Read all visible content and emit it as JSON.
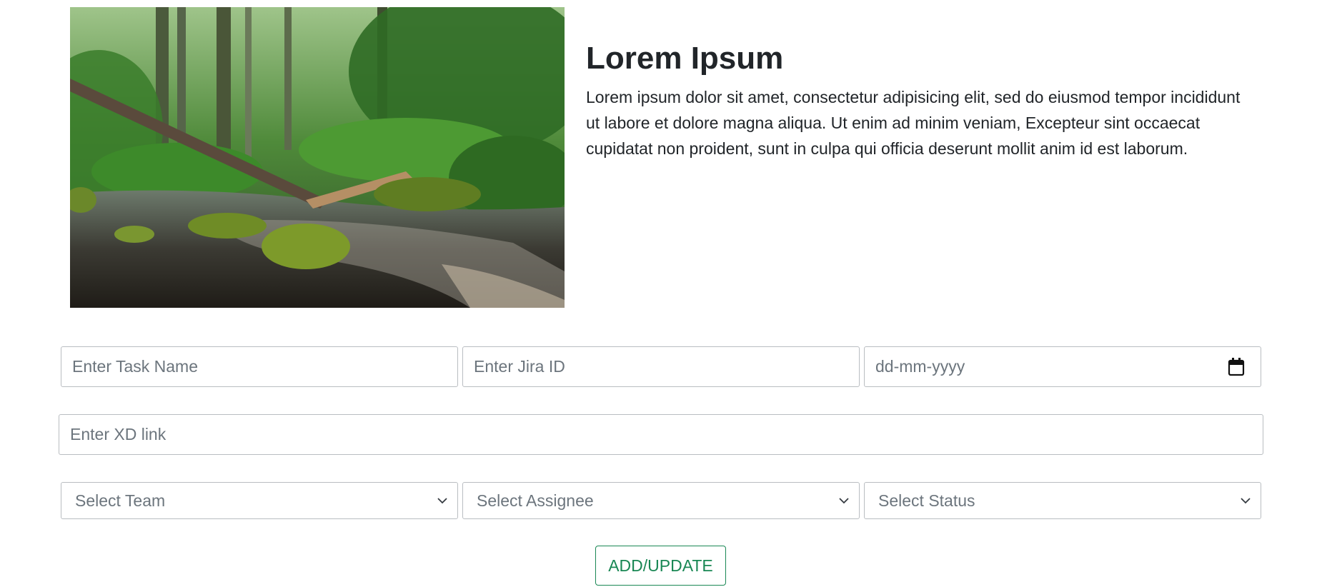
{
  "hero": {
    "image_label": "forest-stream-photo",
    "title": "Lorem Ipsum",
    "description": "Lorem ipsum dolor sit amet, consectetur adipisicing elit, sed do eiusmod tempor incididunt ut labore et dolore magna aliqua. Ut enim ad minim veniam, Excepteur sint occaecat cupidatat non proident, sunt in culpa qui officia deserunt mollit anim id est laborum."
  },
  "form": {
    "task_name_placeholder": "Enter Task Name",
    "jira_id_placeholder": "Enter Jira ID",
    "date_placeholder": "dd-mm-yyyy",
    "xd_link_placeholder": "Enter XD link",
    "team_select": "Select Team",
    "assignee_select": "Select Assignee",
    "status_select": "Select Status",
    "submit_label": "ADD/UPDATE"
  },
  "icons": {
    "date": "calendar-icon",
    "select": "chevron-down-icon"
  },
  "colors": {
    "text": "#212529",
    "placeholder": "#6c757d",
    "border": "#b9bdc1",
    "button_accent": "#198754"
  }
}
